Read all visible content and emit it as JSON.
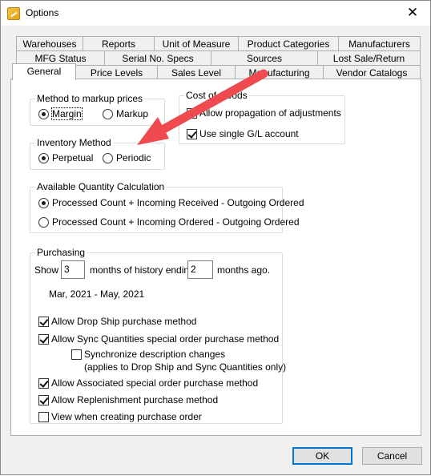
{
  "window": {
    "title": "Options",
    "close_glyph": "✕"
  },
  "tabs": {
    "row1": [
      "Warehouses",
      "Reports",
      "Unit of Measure",
      "Product Categories",
      "Manufacturers"
    ],
    "row2": [
      "MFG Status",
      "Serial No. Specs",
      "Sources",
      "Lost Sale/Return"
    ],
    "row3": [
      "General",
      "Price Levels",
      "Sales Level",
      "Manufacturing",
      "Vendor Catalogs"
    ],
    "active": "General"
  },
  "markup": {
    "legend": "Method to markup prices",
    "margin": "Margin",
    "markup": "Markup",
    "selected": "Margin"
  },
  "inventory": {
    "legend": "Inventory Method",
    "perpetual": "Perpetual",
    "periodic": "Periodic",
    "selected": "Perpetual"
  },
  "cogs": {
    "legend": "Cost of Goods",
    "allow_propagation": "Allow propagation of adjustments",
    "allow_propagation_checked": false,
    "single_gl": "Use single G/L account",
    "single_gl_checked": true
  },
  "availability": {
    "legend": "Available Quantity Calculation",
    "option1": "Processed Count + Incoming Received - Outgoing Ordered",
    "option2": "Processed Count + Incoming Ordered - Outgoing Ordered",
    "selected": 1
  },
  "purchasing": {
    "legend": "Purchasing",
    "show_label": "Show",
    "months_history": "3",
    "months_label": "months of history ending",
    "months_ago": "2",
    "ago_label": "months ago.",
    "date_range": "Mar, 2021 - May, 2021",
    "drop_ship": "Allow Drop Ship purchase method",
    "sync_qty": "Allow Sync Quantities special order purchase method",
    "sync_desc": "Synchronize description changes",
    "sync_desc_note": "(applies to Drop Ship and Sync Quantities only)",
    "associated": "Allow Associated special order purchase method",
    "replenishment": "Allow Replenishment purchase method",
    "view_when": "View when creating purchase order"
  },
  "buttons": {
    "ok": "OK",
    "cancel": "Cancel"
  },
  "colors": {
    "annotation_arrow": "#ee4a4f",
    "focus_border": "#0078d7"
  },
  "icons": {
    "app": "app-icon",
    "close": "close-icon",
    "arrow": "annotation-arrow"
  }
}
